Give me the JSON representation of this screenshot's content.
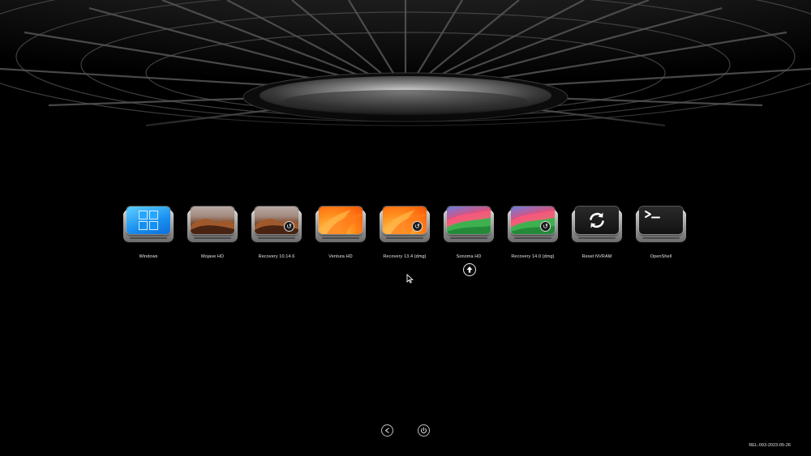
{
  "boot_entries": [
    {
      "label": "Windows",
      "icon": "windows-logo-icon",
      "style": "windows"
    },
    {
      "label": "Mojave HD",
      "icon": "mojave-dunes-icon",
      "style": "mojave"
    },
    {
      "label": "Recovery 10.14.6",
      "icon": "mojave-dunes-icon",
      "style": "mojave",
      "badge": "recovery-clock-icon"
    },
    {
      "label": "Ventura HD",
      "icon": "ventura-wave-icon",
      "style": "ventura"
    },
    {
      "label": "Recovery 13.4 (dmg)",
      "icon": "ventura-wave-icon",
      "style": "ventura",
      "badge": "recovery-clock-icon"
    },
    {
      "label": "Sonoma HD",
      "icon": "sonoma-hills-icon",
      "style": "sonoma",
      "selected": true
    },
    {
      "label": "Recovery 14.0 (dmg)",
      "icon": "sonoma-hills-icon",
      "style": "sonoma",
      "badge": "recovery-clock-icon"
    },
    {
      "label": "Reset NVRAM",
      "icon": "reset-nvram-arrows-icon",
      "style": "dark"
    },
    {
      "label": "OpenShell",
      "icon": "terminal-prompt-icon",
      "style": "dark"
    }
  ],
  "selection_indicator_icon": "up-arrow-icon",
  "bottom_controls": [
    {
      "name": "restart-button",
      "icon": "restart-icon"
    },
    {
      "name": "shutdown-button",
      "icon": "power-icon"
    }
  ],
  "version_text": "REL-093-2023-05-26",
  "colors": {
    "background": "#000000",
    "label_text": "#e8e8e8",
    "windows_blue": "#1a8ff0",
    "ventura_orange": "#ff8a1a"
  }
}
